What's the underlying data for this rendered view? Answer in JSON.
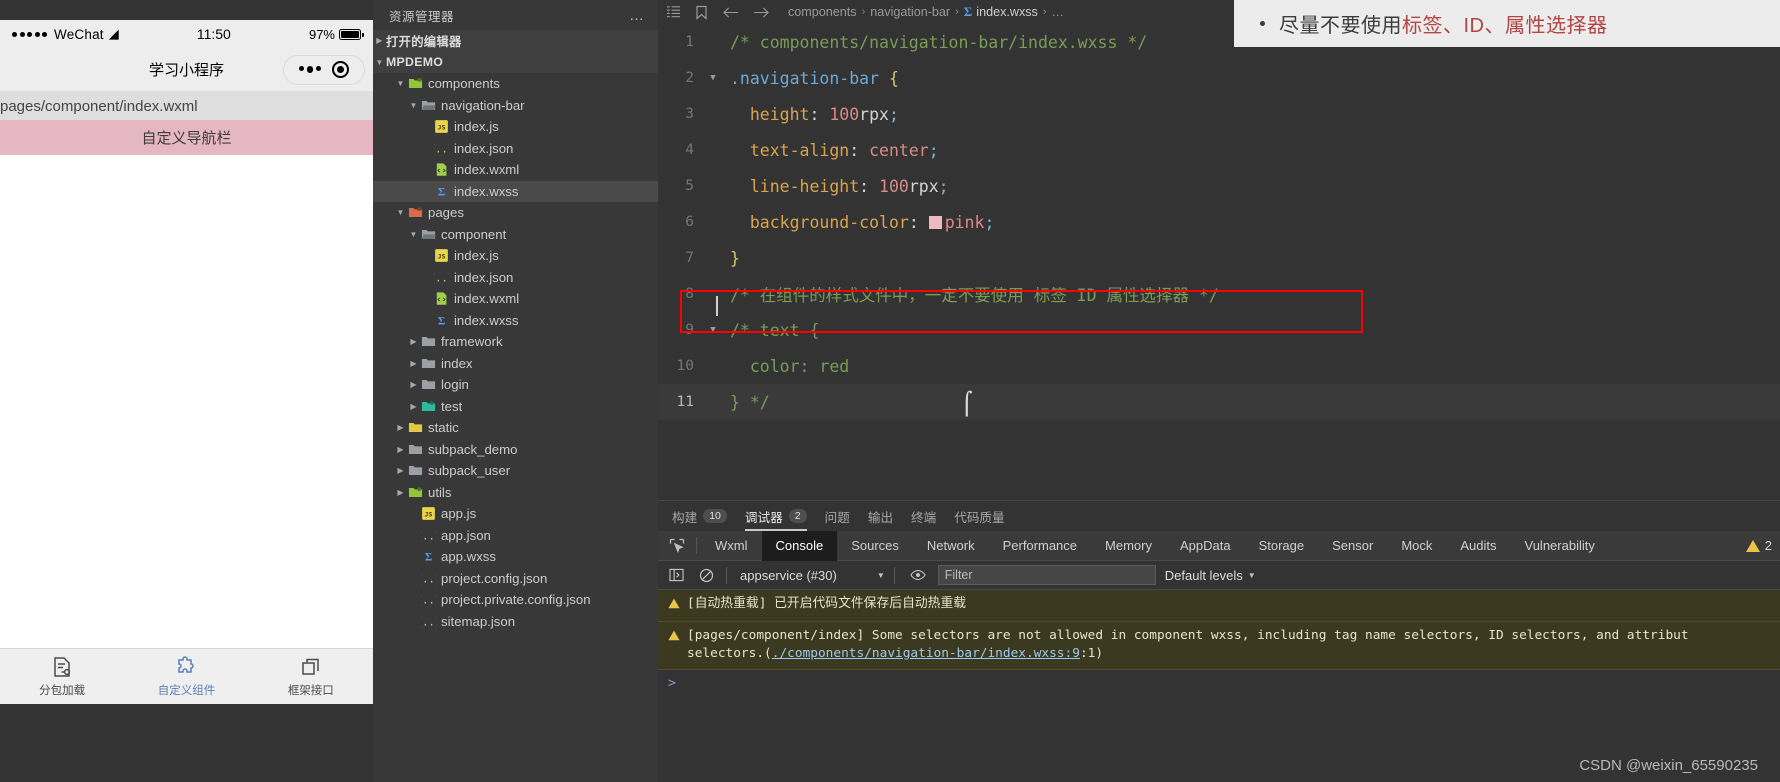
{
  "simulator": {
    "status_bar": {
      "carrier": "WeChat",
      "time": "11:50",
      "battery": "97%"
    },
    "nav_title": "学习小程序",
    "page_path": "pages/component/index.wxml",
    "custom_navbar_text": "自定义导航栏",
    "tabbar": [
      {
        "label": "分包加载",
        "icon": "subpackage-icon",
        "active": false
      },
      {
        "label": "自定义组件",
        "icon": "puzzle-icon",
        "active": true
      },
      {
        "label": "框架接口",
        "icon": "layers-icon",
        "active": false
      }
    ]
  },
  "explorer": {
    "title": "资源管理器",
    "more_label": "…",
    "open_editors": "打开的编辑器",
    "project_name": "MPDEMO",
    "tree": [
      {
        "name": "components",
        "type": "folder",
        "indent": 1,
        "expanded": true,
        "icon": "folder-components"
      },
      {
        "name": "navigation-bar",
        "type": "folder",
        "indent": 2,
        "expanded": true,
        "icon": "folder-open"
      },
      {
        "name": "index.js",
        "type": "js",
        "indent": 3,
        "icon": "js-icon"
      },
      {
        "name": "index.json",
        "type": "json",
        "indent": 3,
        "icon": "json-icon"
      },
      {
        "name": "index.wxml",
        "type": "wxml",
        "indent": 3,
        "icon": "wxml-icon"
      },
      {
        "name": "index.wxss",
        "type": "wxss",
        "indent": 3,
        "icon": "wxss-icon",
        "selected": true
      },
      {
        "name": "pages",
        "type": "folder",
        "indent": 1,
        "expanded": true,
        "icon": "folder-pages"
      },
      {
        "name": "component",
        "type": "folder",
        "indent": 2,
        "expanded": true,
        "icon": "folder-open"
      },
      {
        "name": "index.js",
        "type": "js",
        "indent": 3,
        "icon": "js-icon"
      },
      {
        "name": "index.json",
        "type": "json",
        "indent": 3,
        "icon": "json-icon"
      },
      {
        "name": "index.wxml",
        "type": "wxml",
        "indent": 3,
        "icon": "wxml-icon"
      },
      {
        "name": "index.wxss",
        "type": "wxss",
        "indent": 3,
        "icon": "wxss-icon"
      },
      {
        "name": "framework",
        "type": "folder",
        "indent": 2,
        "expanded": false,
        "icon": "folder"
      },
      {
        "name": "index",
        "type": "folder",
        "indent": 2,
        "expanded": false,
        "icon": "folder"
      },
      {
        "name": "login",
        "type": "folder",
        "indent": 2,
        "expanded": false,
        "icon": "folder"
      },
      {
        "name": "test",
        "type": "folder",
        "indent": 2,
        "expanded": false,
        "icon": "folder-test"
      },
      {
        "name": "static",
        "type": "folder",
        "indent": 1,
        "expanded": false,
        "icon": "folder-static"
      },
      {
        "name": "subpack_demo",
        "type": "folder",
        "indent": 1,
        "expanded": false,
        "icon": "folder"
      },
      {
        "name": "subpack_user",
        "type": "folder",
        "indent": 1,
        "expanded": false,
        "icon": "folder"
      },
      {
        "name": "utils",
        "type": "folder",
        "indent": 1,
        "expanded": false,
        "icon": "folder-utils"
      },
      {
        "name": "app.js",
        "type": "js",
        "indent": 2,
        "icon": "js-icon"
      },
      {
        "name": "app.json",
        "type": "json",
        "indent": 2,
        "icon": "json-icon"
      },
      {
        "name": "app.wxss",
        "type": "wxss",
        "indent": 2,
        "icon": "wxss-icon"
      },
      {
        "name": "project.config.json",
        "type": "json",
        "indent": 2,
        "icon": "json-icon"
      },
      {
        "name": "project.private.config.json",
        "type": "json",
        "indent": 2,
        "icon": "json-icon"
      },
      {
        "name": "sitemap.json",
        "type": "json",
        "indent": 2,
        "icon": "json-icon"
      }
    ]
  },
  "editor": {
    "breadcrumb": [
      "components",
      "navigation-bar",
      "index.wxss",
      "…"
    ],
    "breadcrumb_file": "index.wxss",
    "lines": [
      {
        "n": "1",
        "fold": "",
        "tokens": [
          {
            "t": "/* components/navigation-bar/index.wxss */",
            "c": "c-comment"
          }
        ]
      },
      {
        "n": "2",
        "fold": "v",
        "tokens": [
          {
            "t": ".navigation-bar ",
            "c": "c-sel"
          },
          {
            "t": "{",
            "c": "c-brace"
          }
        ]
      },
      {
        "n": "3",
        "fold": "",
        "tokens": [
          {
            "t": "  height",
            "c": "c-prop"
          },
          {
            "t": ": ",
            "c": "c-white"
          },
          {
            "t": "100",
            "c": "c-val"
          },
          {
            "t": "rpx",
            "c": "c-white"
          },
          {
            "t": ";",
            "c": "c-punc"
          }
        ]
      },
      {
        "n": "4",
        "fold": "",
        "tokens": [
          {
            "t": "  text-align",
            "c": "c-prop"
          },
          {
            "t": ": ",
            "c": "c-white"
          },
          {
            "t": "center",
            "c": "c-val"
          },
          {
            "t": ";",
            "c": "c-punc"
          }
        ]
      },
      {
        "n": "5",
        "fold": "",
        "tokens": [
          {
            "t": "  line-height",
            "c": "c-prop"
          },
          {
            "t": ": ",
            "c": "c-white"
          },
          {
            "t": "100",
            "c": "c-val"
          },
          {
            "t": "rpx",
            "c": "c-white"
          },
          {
            "t": ";",
            "c": "c-punc"
          }
        ]
      },
      {
        "n": "6",
        "fold": "",
        "swatch": "#f0b8c4",
        "tokens": [
          {
            "t": "  background-color",
            "c": "c-prop"
          },
          {
            "t": ": ",
            "c": "c-white"
          },
          {
            "t": "pink",
            "c": "c-val"
          },
          {
            "t": ";",
            "c": "c-punc"
          }
        ]
      },
      {
        "n": "7",
        "fold": "",
        "tokens": [
          {
            "t": "}",
            "c": "c-brace"
          }
        ]
      },
      {
        "n": "8",
        "fold": "",
        "highlight": true,
        "tokens": [
          {
            "t": "/* 在组件的样式文件中，一定不要使用 标签 ID 属性选择器 */",
            "c": "c-comment"
          }
        ]
      },
      {
        "n": "9",
        "fold": "v",
        "tokens": [
          {
            "t": "/* text {",
            "c": "c-comment"
          }
        ]
      },
      {
        "n": "10",
        "fold": "",
        "tokens": [
          {
            "t": "  color: red",
            "c": "c-comment"
          }
        ]
      },
      {
        "n": "11",
        "fold": "",
        "current": true,
        "tokens": [
          {
            "t": "} */",
            "c": "c-comment"
          }
        ]
      }
    ]
  },
  "devtools": {
    "panel_tabs": [
      {
        "label": "构建",
        "count": "10",
        "active": false
      },
      {
        "label": "调试器",
        "count": "2",
        "active": true
      },
      {
        "label": "问题",
        "count": "",
        "active": false
      },
      {
        "label": "输出",
        "count": "",
        "active": false
      },
      {
        "label": "终端",
        "count": "",
        "active": false
      },
      {
        "label": "代码质量",
        "count": "",
        "active": false
      }
    ],
    "devtool_tabs": [
      "Wxml",
      "Console",
      "Sources",
      "Network",
      "Performance",
      "Memory",
      "AppData",
      "Storage",
      "Sensor",
      "Mock",
      "Audits",
      "Vulnerability"
    ],
    "active_devtool_tab": "Console",
    "warning_count": "2",
    "console_toolbar": {
      "context": "appservice (#30)",
      "filter_placeholder": "Filter",
      "levels": "Default levels"
    },
    "logs": [
      {
        "type": "warning",
        "text": "[自动热重载] 已开启代码文件保存后自动热重载",
        "link": ""
      },
      {
        "type": "warning",
        "text": "[pages/component/index] Some selectors are not allowed in component wxss, including tag name selectors, ID selectors, and attribut",
        "text2_prefix": "selectors.(",
        "link": "./components/navigation-bar/index.wxss:9",
        "text2_suffix": ":1)"
      }
    ],
    "prompt": ">"
  },
  "note_overlay": {
    "bullet": "•",
    "prefix": "尽量不要使用",
    "highlight": "标签、ID、属性选择器"
  },
  "watermark": "CSDN @weixin_65590235",
  "colors": {
    "accent_pink": "#e5b7c2",
    "red_box": "#ff0000",
    "warning_bg": "#3b3a20",
    "active_tab_blue": "#5a7fb5"
  }
}
